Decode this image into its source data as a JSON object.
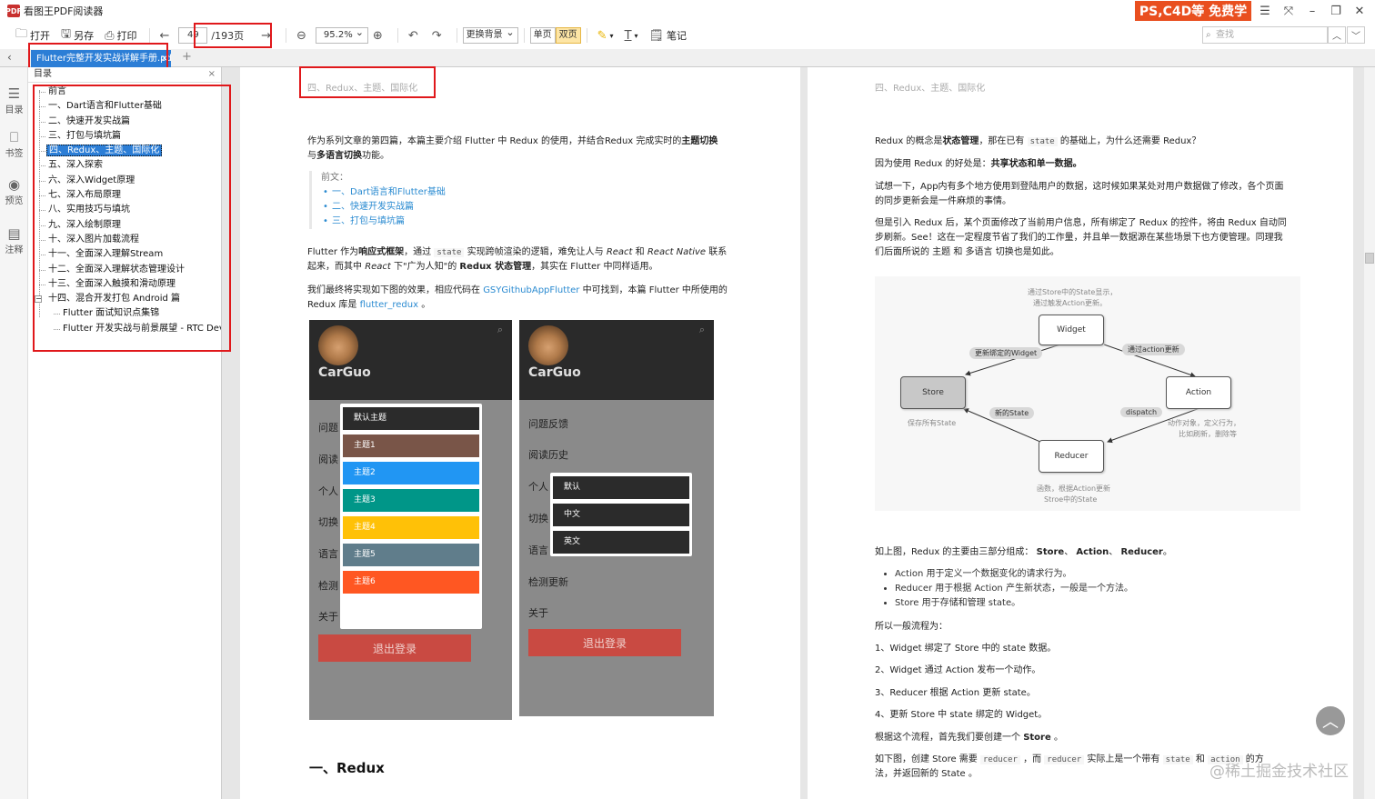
{
  "app": {
    "icon_text": "PDF",
    "title": "看图王PDF阅读器",
    "promo": "PS,C4D等 免费学"
  },
  "toolbar": {
    "open": "打开",
    "save_as": "另存",
    "print": "打印",
    "page_current": "49",
    "page_total": "/193页",
    "zoom": "95.2%",
    "background": "更换背景",
    "single": "单页",
    "double": "双页",
    "notes": "笔记",
    "search_placeholder": "查找"
  },
  "tab": {
    "label": "Flutter完整开发实战详解手册.pdf"
  },
  "leftbar": {
    "toc": "目录",
    "bookmarks": "书签",
    "preview": "预览",
    "annotations": "注释"
  },
  "toc": {
    "title": "目录",
    "items": [
      {
        "label": "前言"
      },
      {
        "label": "一、Dart语言和Flutter基础"
      },
      {
        "label": "二、快速开发实战篇"
      },
      {
        "label": "三、打包与填坑篇"
      },
      {
        "label": "四、Redux、主题、国际化"
      },
      {
        "label": "五、深入探索"
      },
      {
        "label": "六、深入Widget原理"
      },
      {
        "label": "七、深入布局原理"
      },
      {
        "label": "八、实用技巧与填坑"
      },
      {
        "label": "九、深入绘制原理"
      },
      {
        "label": "十、深入图片加载流程"
      },
      {
        "label": "十一、全面深入理解Stream"
      },
      {
        "label": "十二、全面深入理解状态管理设计"
      },
      {
        "label": "十三、全面深入触摸和滑动原理"
      },
      {
        "label": "十四、混合开发打包 Android 篇"
      },
      {
        "label": "Flutter 面试知识点集锦"
      },
      {
        "label": "Flutter 开发实战与前景展望 - RTC Dev M"
      }
    ]
  },
  "page1": {
    "running_head": "四、Redux、主题、国际化",
    "intro_a": "作为系列文章的第四篇，本篇主要介绍 Flutter 中 Redux 的使用，并结合Redux 完成实时的",
    "intro_b": "主题切换",
    "intro_c": "与",
    "intro_d": "多语言切换",
    "intro_e": "功能。",
    "prev_label": "前文：",
    "prev_items": [
      "一、Dart语言和Flutter基础",
      "二、快速开发实战篇",
      "三、打包与填坑篇"
    ],
    "p2_a": "Flutter 作为",
    "p2_b": "响应式框架",
    "p2_c": "，通过",
    "p2_code": "state",
    "p2_d": "实现跨帧渲染的逻辑，难免让人与",
    "p2_e": "React",
    "p2_f": "和",
    "p2_g": "React Native",
    "p2_h": "联系",
    "p2_line2a": "起来，而其中",
    "p2_line2b": "React",
    "p2_line2c": "下\"广为人知\"的",
    "p2_line2d": "Redux 状态管理",
    "p2_line2e": "，其实在 Flutter 中同样适用。",
    "p3_a": "我们最终将实现如下图的效果，相应代码在",
    "p3_link": "GSYGithubAppFlutter",
    "p3_b": "中可找到，本篇 Flutter 中所使用的",
    "p3_c": "Redux 库是",
    "p3_link2": "flutter_redux",
    "p3_d": "。",
    "phone_brand": "CarGuo",
    "phone1_menu": [
      "问题",
      "阅读",
      "个人",
      "切换",
      "语言",
      "检测",
      "关于"
    ],
    "phone2_menu": [
      "问题反馈",
      "阅读历史",
      "个人",
      "切换",
      "语言",
      "检测更新",
      "关于"
    ],
    "logout": "退出登录",
    "theme_options": [
      "默认主题",
      "主题1",
      "主题2",
      "主题3",
      "主题4",
      "主题5",
      "主题6"
    ],
    "theme_colors": [
      "#2b2b2b",
      "#795548",
      "#2196f3",
      "#009688",
      "#ffc107",
      "#607d8b",
      "#ff5722"
    ],
    "lang_options": [
      "默认",
      "中文",
      "英文"
    ],
    "heading": "一、Redux"
  },
  "page2": {
    "running_head": "四、Redux、主题、国际化",
    "l1_a": "Redux 的概念是",
    "l1_b": "状态管理",
    "l1_c": "，那在已有",
    "l1_code": "state",
    "l1_d": "的基础上，为什么还需要 Redux？",
    "l2_a": "因为使用 Redux 的好处是：",
    "l2_b": "共享状态和单一数据。",
    "l3": "试想一下，App内有多个地方使用到登陆用户的数据，这时候如果某处对用户数据做了修改，各个页面",
    "l3b": "的同步更新会是一件麻烦的事情。",
    "l4": "但是引入 Redux 后，某个页面修改了当前用户信息，所有绑定了 Redux 的控件，将由 Redux 自动同",
    "l4b": "步刷新。See！这在一定程度节省了我们的工作量，并且单一数据源在某些场景下也方便管理。同理我",
    "l4c": "们后面所说的 主题 和 多语言 切换也是如此。",
    "diagram": {
      "top_note1": "通过Store中的State显示，",
      "top_note2": "通过触发Action更新。",
      "widget": "Widget",
      "store": "Store",
      "action": "Action",
      "reducer": "Reducer",
      "b_bind": "更新绑定的Widget",
      "b_action": "通过action更新",
      "b_newstate": "新的State",
      "b_dispatch": "dispatch",
      "store_note": "保存所有State",
      "action_note1": "动作对象，定义行为，",
      "action_note2": "比如刷新，删除等",
      "reducer_note1": "函数，根据Action更新",
      "reducer_note2": "Stroe中的State"
    },
    "l5_a": "如上图，Redux 的主要由三部分组成：",
    "l5_b": "Store",
    "l5_c": "、",
    "l5_d": "Action",
    "l5_e": "、",
    "l5_f": "Reducer",
    "l5_g": "。",
    "bullets": [
      "Action 用于定义一个数据变化的请求行为。",
      "Reducer 用于根据 Action 产生新状态，一般是一个方法。",
      "Store 用于存储和管理 state。"
    ],
    "flow_title": "所以一般流程为：",
    "steps": [
      "1、Widget 绑定了 Store 中的 state 数据。",
      "2、Widget 通过 Action 发布一个动作。",
      "3、Reducer 根据 Action 更新 state。",
      "4、更新 Store 中 state 绑定的 Widget。"
    ],
    "l6_a": "根据这个流程，首先我们要创建一个",
    "l6_b": "Store",
    "l6_c": "。",
    "l7_a": "如下图，创建 Store 需要",
    "l7_code1": "reducer",
    "l7_b": "，而",
    "l7_code2": "reducer",
    "l7_c": "实际上是一个带有",
    "l7_code3": "state",
    "l7_d": "和",
    "l7_code4": "action",
    "l7_e": "的方",
    "l7_f": "法，并返回新的 State 。"
  },
  "watermark": "@稀土掘金技术社区"
}
